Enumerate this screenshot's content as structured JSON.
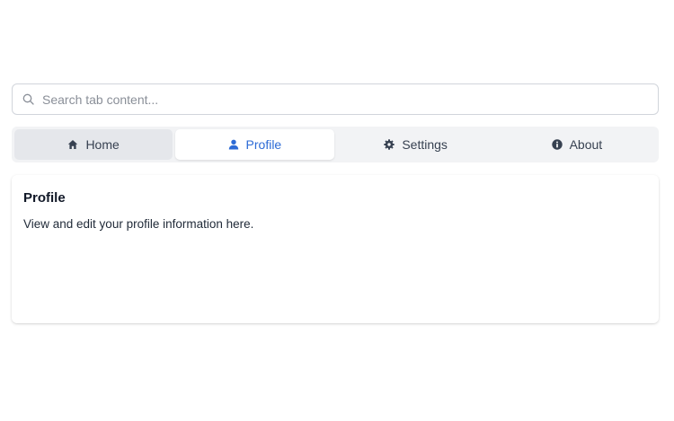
{
  "search": {
    "placeholder": "Search tab content..."
  },
  "tabs": [
    {
      "label": "Home",
      "icon": "home-icon",
      "state": "hover"
    },
    {
      "label": "Profile",
      "icon": "user-icon",
      "state": "active"
    },
    {
      "label": "Settings",
      "icon": "gear-icon",
      "state": "default"
    },
    {
      "label": "About",
      "icon": "info-icon",
      "state": "default"
    }
  ],
  "panel": {
    "title": "Profile",
    "body": "View and edit your profile information here."
  },
  "colors": {
    "accent": "#2d6bd6",
    "tab_bar_bg": "#f2f3f5",
    "hover_bg": "#e5e7eb"
  }
}
